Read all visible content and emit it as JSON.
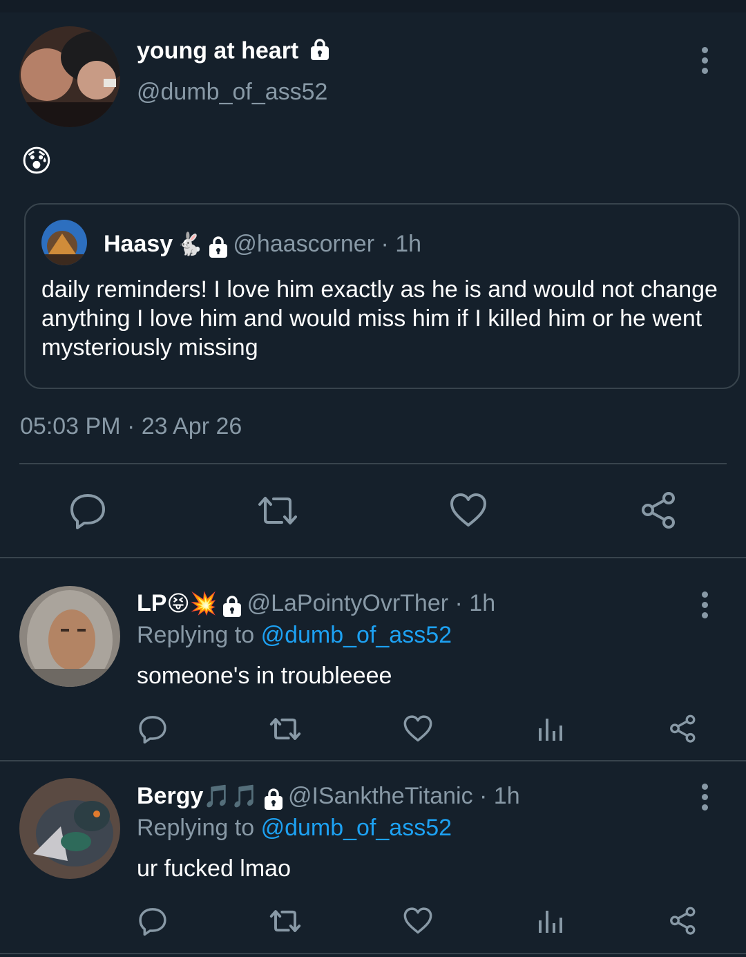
{
  "main_tweet": {
    "display_name": "young at heart",
    "handle": "@dumb_of_ass52",
    "emoji_text": "😰",
    "timestamp": "05:03 PM · 23 Apr 26",
    "quote": {
      "display_name": "Haasy",
      "name_emoji": "🐇",
      "handle_time": "@haascorner · 1h",
      "text": "daily reminders! I love him exactly as he is and would not change anything I love him and would miss him if I killed him or he went mysteriously missing"
    }
  },
  "replies": [
    {
      "display_name": "LP",
      "name_emoji": "😝💥",
      "handle_time": "@LaPointyOvrTher · 1h",
      "replying_prefix": "Replying to",
      "replying_handle": "@dumb_of_ass52",
      "text": "someone's in troubleeee"
    },
    {
      "display_name": "Bergy",
      "name_emoji": "🎵🎵",
      "handle_time": "@ISanktheTitanic · 1h",
      "replying_prefix": "Replying to",
      "replying_handle": "@dumb_of_ass52",
      "text": "ur fucked lmao"
    }
  ],
  "colors": {
    "background": "#15202b",
    "muted": "#8899a6",
    "link": "#1da1f2",
    "divider": "#38444d"
  },
  "icons": [
    "lock-icon",
    "more-options-icon",
    "reply-icon",
    "retweet-icon",
    "like-icon",
    "analytics-icon",
    "share-icon"
  ]
}
